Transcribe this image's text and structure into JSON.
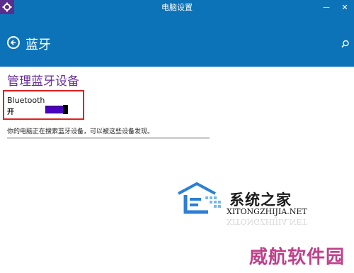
{
  "window": {
    "title": "电脑设置",
    "minimize_glyph": "—",
    "close_glyph": "✕"
  },
  "header": {
    "title": "蓝牙"
  },
  "section": {
    "title": "管理蓝牙设备",
    "bluetooth_label": "Bluetooth",
    "bluetooth_state": "开",
    "bluetooth_on": true,
    "description": "你的电脑正在搜索蓝牙设备，可以被这些设备发现。"
  },
  "watermark": {
    "cn": "系统之家",
    "en": "XITONGZHIJIA.NET",
    "brand": "威航软件园"
  },
  "colors": {
    "header": "#0d73b9",
    "section_title": "#6a2ea0",
    "toggle": "#4b00c2",
    "highlight": "#e02020"
  },
  "icons": [
    "app-gear-icon",
    "back-arrow-icon",
    "search-icon"
  ]
}
